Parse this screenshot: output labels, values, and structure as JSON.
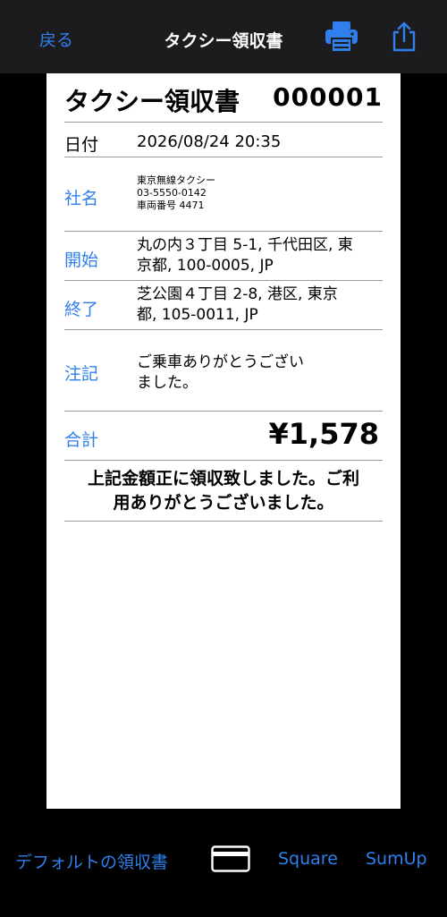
{
  "nav": {
    "back_label": "戻る",
    "title": "タクシー領収書",
    "print_icon": "printer-icon",
    "share_icon": "share-icon"
  },
  "receipt": {
    "title": "タクシー領収書",
    "number": "000001",
    "date_label": "日付",
    "date_value": "2026/08/24 20:35",
    "company_label": "社名",
    "company_name": "東京無線タクシー",
    "company_phone": "03-5550-0142",
    "vehicle_number": "車両番号 4471",
    "start_label": "開始",
    "start_line1": "丸の内３丁目 5-1, 千代田区, 東",
    "start_line2": "京都, 100-0005, JP",
    "end_label": "終了",
    "end_line1": "芝公園４丁目 2-8, 港区, 東京",
    "end_line2": "都, 105-0011, JP",
    "note_label": "注記",
    "note_line1": "ご乗車ありがとうござい",
    "note_line2": "ました。",
    "total_label": "合計",
    "total_value": "¥1,578",
    "thanks_line1": "上記金額正に領収致しました。ご利",
    "thanks_line2": "用ありがとうございました。"
  },
  "bottom": {
    "default_label": "デフォルトの領収書",
    "card_icon": "credit-card-icon",
    "square_label": "Square",
    "sumup_label": "SumUp"
  },
  "colors": {
    "accent": "#2f80ed",
    "nav_bg": "#1c1c1e",
    "background": "#000000",
    "paper": "#ffffff"
  }
}
